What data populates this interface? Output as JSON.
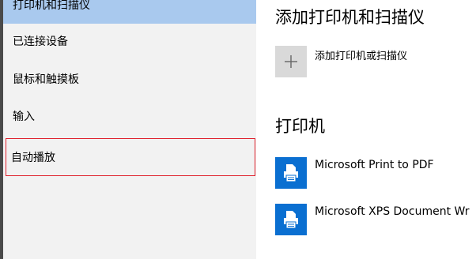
{
  "sidebar": {
    "items": [
      {
        "label": "打印机和扫描仪"
      },
      {
        "label": "已连接设备"
      },
      {
        "label": "鼠标和触摸板"
      },
      {
        "label": "输入"
      },
      {
        "label": "自动播放"
      }
    ]
  },
  "main": {
    "section_add_title": "添加打印机和扫描仪",
    "add_button_icon": "plus-icon",
    "add_button_label": "添加打印机或扫描仪",
    "section_printers_title": "打印机",
    "printers": [
      {
        "name": "Microsoft Print to PDF",
        "icon": "printer-icon"
      },
      {
        "name": "Microsoft XPS Document Wr",
        "icon": "printer-icon"
      }
    ]
  },
  "colors": {
    "selected_bg": "#a9c9ee",
    "sidebar_bg": "#f2f2f2",
    "highlight_border": "#e0212d",
    "printer_tile": "#0a6fd1",
    "add_tile": "#d9d9d9"
  }
}
